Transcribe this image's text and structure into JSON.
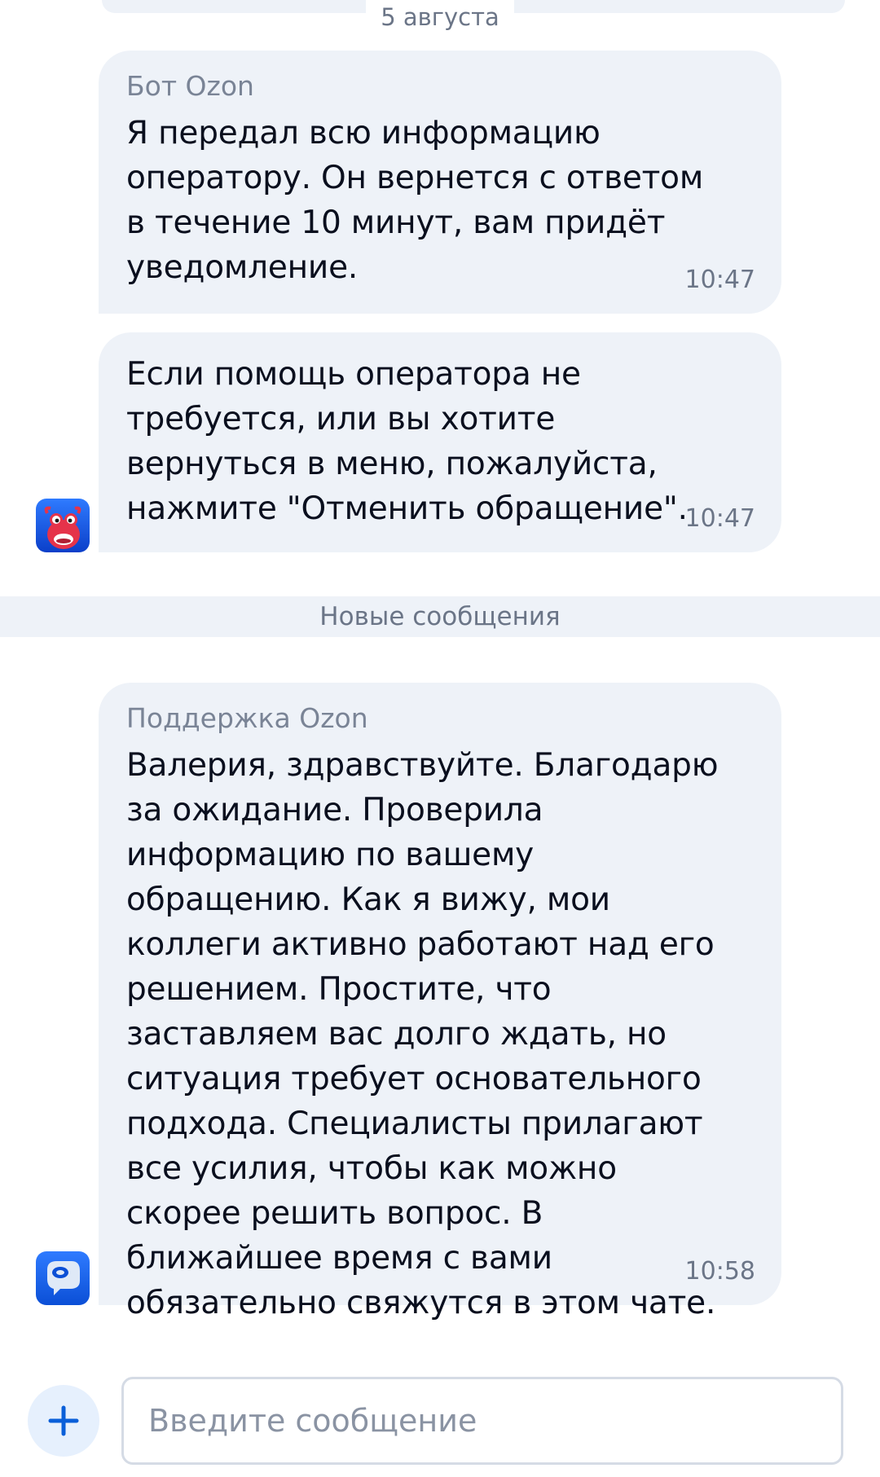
{
  "chat": {
    "date_label": "5 августа",
    "new_messages_label": "Новые сообщения",
    "messages": [
      {
        "sender": "Бот Ozon",
        "text": "Я передал всю информацию оператору. Он вернется с ответом в течение 10 минут, вам придёт уведомление.",
        "time": "10:47"
      },
      {
        "sender": "",
        "text": "Если помощь оператора не требуется, или вы хотите вернуться в меню, пожалуйста, нажмите \"Отменить обращение\".",
        "time": "10:47",
        "avatar": "bot-mascot-icon"
      },
      {
        "sender": "Поддержка Ozon",
        "text": "Валерия, здравствуйте. Благодарю за ожидание. Проверила информацию по вашему обращению. Как я вижу, мои коллеги активно работают над его решением. Простите, что заставляем вас долго ждать, но ситуация требует основательного подхода. Специалисты прилагают все усилия, чтобы как можно скорее решить вопрос. В ближайшее время с вами обязательно свяжутся в этом чате.",
        "time": "10:58",
        "avatar": "support-chat-icon"
      }
    ]
  },
  "composer": {
    "placeholder": "Введите сообщение",
    "value": "",
    "attach_icon": "plus-icon"
  },
  "colors": {
    "bubble_bg": "#eef2f8",
    "accent": "#0a5fd9",
    "muted_text": "#6b7587"
  }
}
